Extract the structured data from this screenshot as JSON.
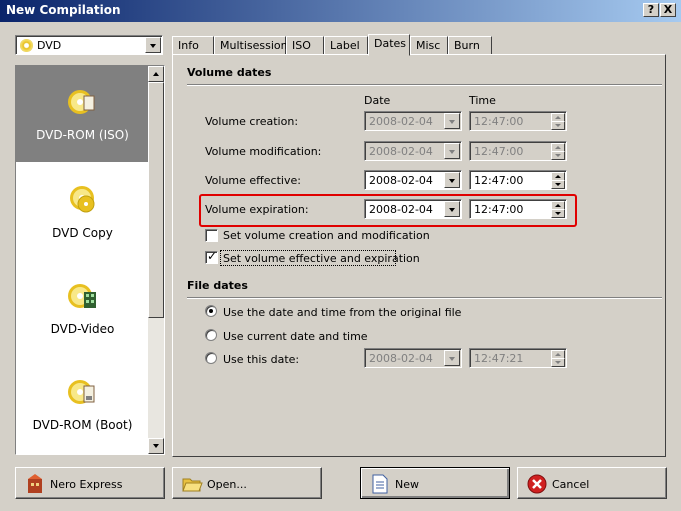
{
  "window": {
    "title": "New Compilation",
    "help_btn": "?",
    "close_btn": "X"
  },
  "media_select": {
    "value": "DVD"
  },
  "compile_types": [
    {
      "label": "DVD-ROM (ISO)",
      "icon": "dvd-rom-iso-icon",
      "selected": true
    },
    {
      "label": "DVD Copy",
      "icon": "dvd-copy-icon"
    },
    {
      "label": "DVD-Video",
      "icon": "dvd-video-icon"
    },
    {
      "label": "DVD-ROM (Boot)",
      "icon": "dvd-rom-boot-icon"
    }
  ],
  "tabs": [
    "Info",
    "Multisession",
    "ISO",
    "Label",
    "Dates",
    "Misc",
    "Burn"
  ],
  "active_tab": "Dates",
  "volume_dates": {
    "heading": "Volume dates",
    "col_date": "Date",
    "col_time": "Time",
    "rows": [
      {
        "label": "Volume creation:",
        "date": "2008-02-04",
        "time": "12:47:00",
        "enabled": false
      },
      {
        "label": "Volume modification:",
        "date": "2008-02-04",
        "time": "12:47:00",
        "enabled": false
      },
      {
        "label": "Volume effective:",
        "date": "2008-02-04",
        "time": "12:47:00",
        "enabled": true
      },
      {
        "label": "Volume expiration:",
        "date": "2008-02-04",
        "time": "12:47:00",
        "enabled": true
      }
    ],
    "chk_creation": {
      "label": "Set volume creation and modification",
      "checked": false
    },
    "chk_effective": {
      "label": "Set volume effective and expiration",
      "checked": true
    }
  },
  "file_dates": {
    "heading": "File dates",
    "opt_original": {
      "label": "Use the date and time from the original file",
      "checked": true
    },
    "opt_current": {
      "label": "Use current date and time",
      "checked": false
    },
    "opt_this": {
      "label": "Use this date:",
      "checked": false,
      "date": "2008-02-04",
      "time": "12:47:21"
    }
  },
  "buttons": {
    "nero_express": "Nero Express",
    "open": "Open...",
    "new": "New",
    "cancel": "Cancel"
  },
  "colors": {
    "title_start": "#0a246a",
    "title_end": "#a6caf0",
    "highlight": "#e00000"
  }
}
